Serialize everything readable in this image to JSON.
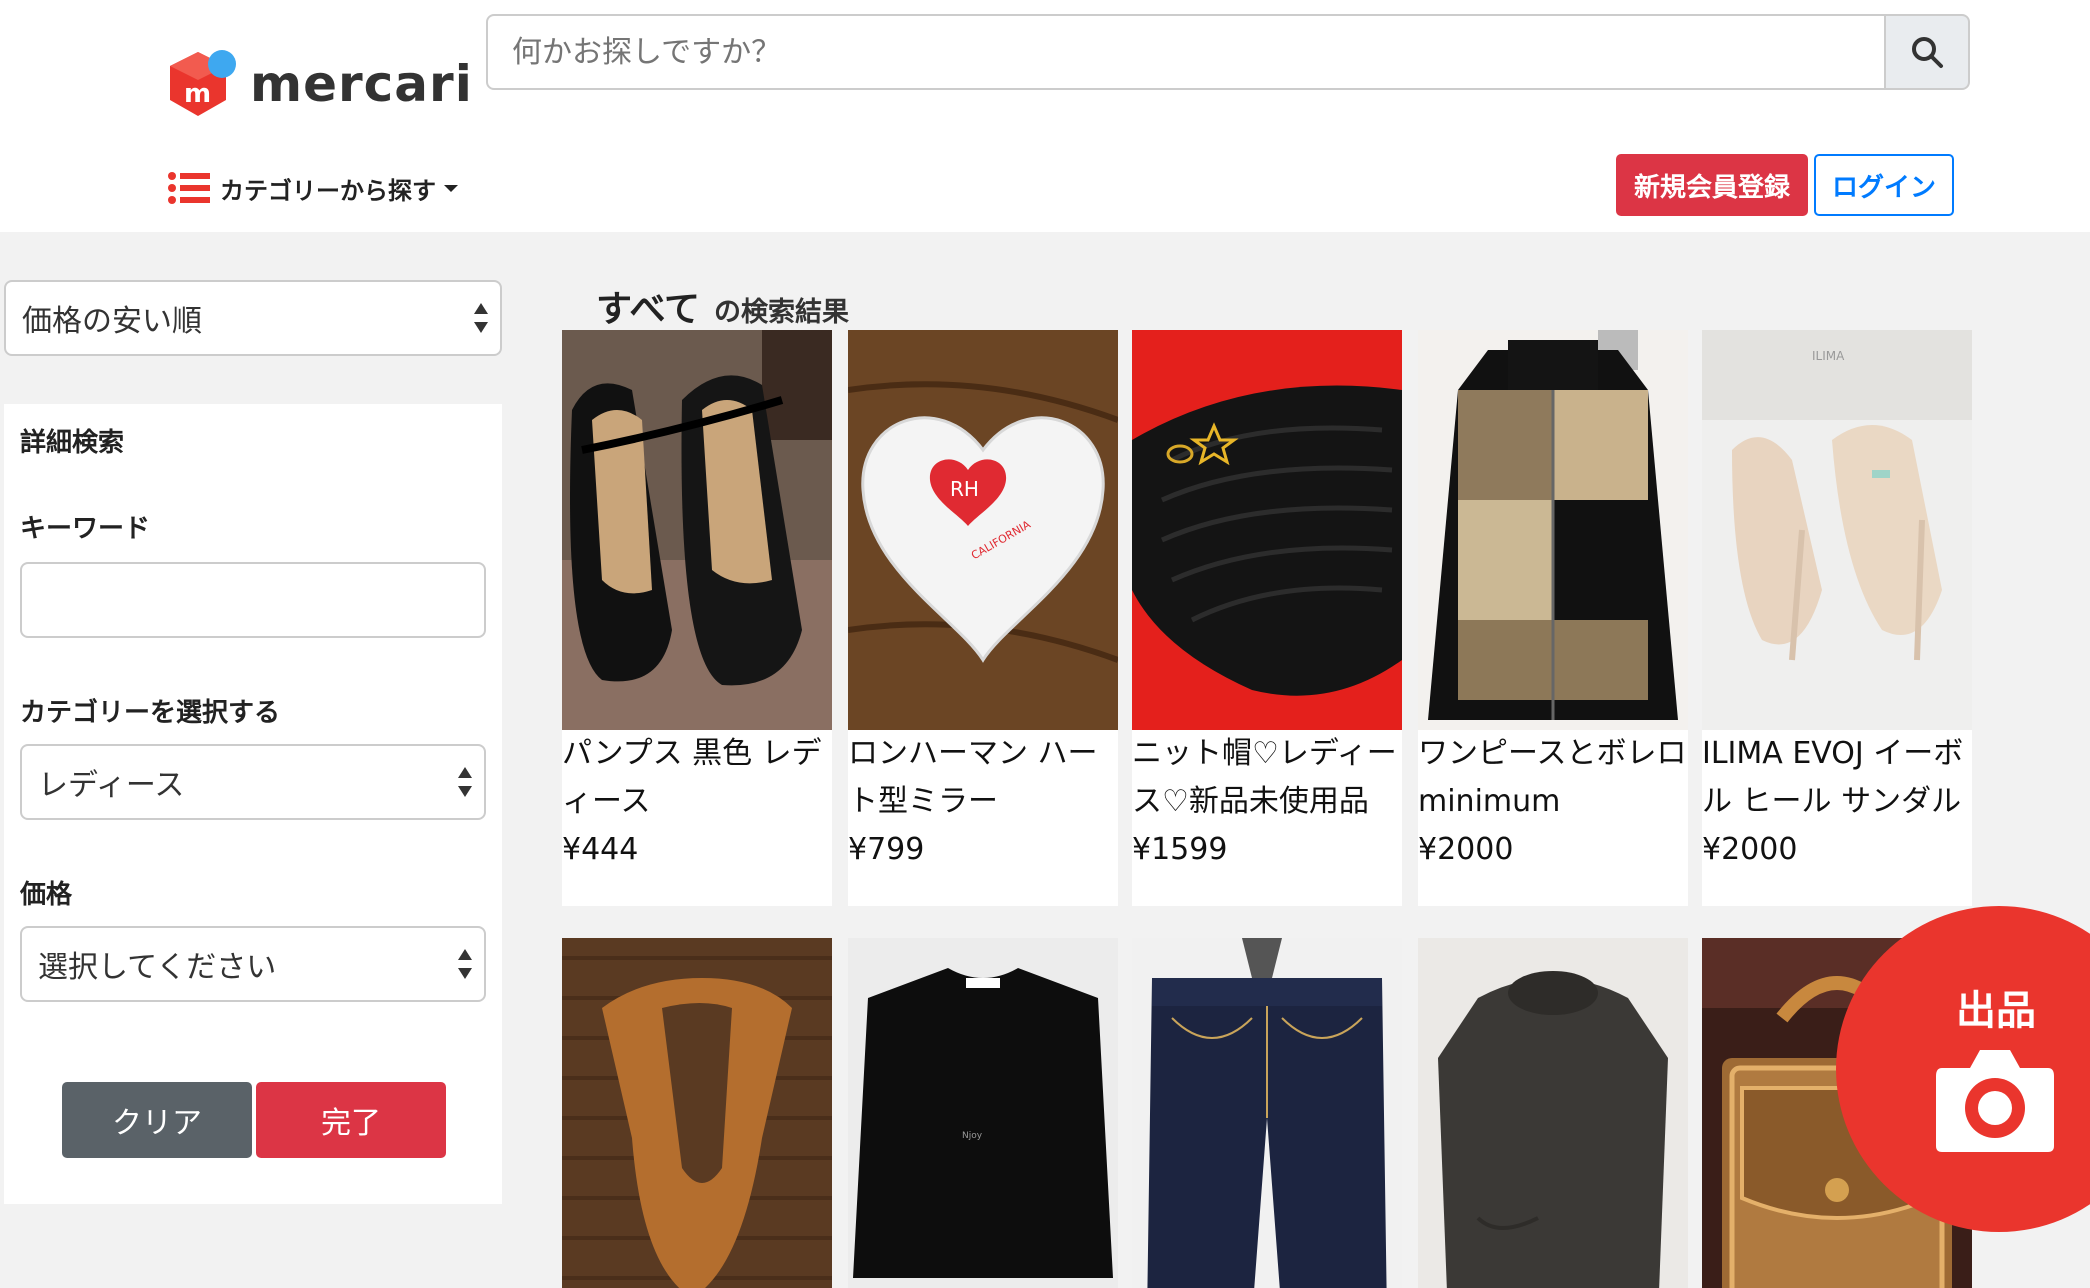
{
  "header": {
    "logo_text": "mercari",
    "search_placeholder": "何かお探しですか？",
    "category_nav_label": "カテゴリーから探す",
    "register_label": "新規会員登録",
    "login_label": "ログイン",
    "brand_red": "#ea352d",
    "brand_blue": "#3ea8f0"
  },
  "sidebar": {
    "sort_value": "価格の安い順",
    "detail_title": "詳細検索",
    "keyword_label": "キーワード",
    "keyword_value": "",
    "category_label": "カテゴリーを選択する",
    "category_value": "レディース",
    "price_label": "価格",
    "price_value": "選択してください",
    "clear_label": "クリア",
    "done_label": "完了"
  },
  "results": {
    "title_main": "すべて",
    "title_sub": "の検索結果",
    "items": [
      {
        "name": "パンプス 黒色 レディース",
        "price": "¥444",
        "image": "black-pumps-photo"
      },
      {
        "name": "ロンハーマン ハート型ミラー",
        "price": "¥799",
        "image": "heart-mirror-photo"
      },
      {
        "name": "ニット帽♡レディース♡新品未使用品",
        "price": "¥1599",
        "image": "knit-hat-photo"
      },
      {
        "name": "ワンピースとボレロ minimum",
        "price": "¥2000",
        "image": "colorblock-cardigan-photo"
      },
      {
        "name": "ILIMA EVOJ イーボル ヒール サンダル",
        "price": "¥2000",
        "image": "heel-sandal-photo"
      },
      {
        "image": "fur-stole-photo"
      },
      {
        "image": "black-top-photo"
      },
      {
        "image": "denim-jeans-photo"
      },
      {
        "image": "grey-sweater-photo"
      },
      {
        "image": "brown-handbag-photo"
      }
    ]
  },
  "sell_button": {
    "label": "出品",
    "icon": "camera-icon"
  }
}
